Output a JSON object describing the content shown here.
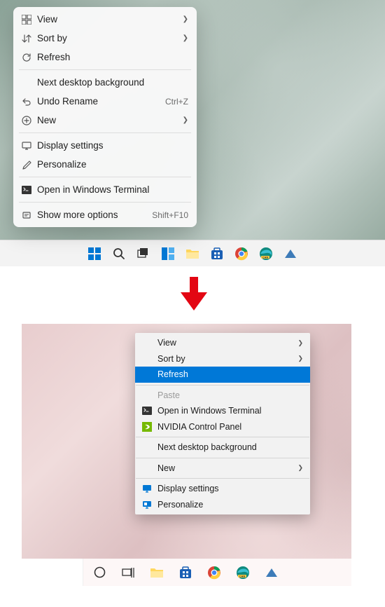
{
  "win11_menu": {
    "items": [
      {
        "label": "View",
        "icon": "view",
        "chevron": true
      },
      {
        "label": "Sort by",
        "icon": "sort",
        "chevron": true
      },
      {
        "label": "Refresh",
        "icon": "refresh"
      }
    ],
    "items2": [
      {
        "label": "Next desktop background"
      },
      {
        "label": "Undo Rename",
        "icon": "undo",
        "shortcut": "Ctrl+Z"
      },
      {
        "label": "New",
        "icon": "new",
        "chevron": true
      }
    ],
    "items3": [
      {
        "label": "Display settings",
        "icon": "display"
      },
      {
        "label": "Personalize",
        "icon": "personalize"
      }
    ],
    "items4": [
      {
        "label": "Open in Windows Terminal",
        "icon": "terminal"
      }
    ],
    "items5": [
      {
        "label": "Show more options",
        "icon": "more",
        "shortcut": "Shift+F10"
      }
    ]
  },
  "win10_menu": {
    "items": [
      {
        "label": "View",
        "chevron": true
      },
      {
        "label": "Sort by",
        "chevron": true
      },
      {
        "label": "Refresh",
        "highlighted": true
      }
    ],
    "items2": [
      {
        "label": "Paste",
        "disabled": true
      },
      {
        "label": "Open in Windows Terminal",
        "icon": "terminal"
      },
      {
        "label": "NVIDIA Control Panel",
        "icon": "nvidia"
      }
    ],
    "items3": [
      {
        "label": "Next desktop background"
      }
    ],
    "items4": [
      {
        "label": "New",
        "chevron": true
      }
    ],
    "items5": [
      {
        "label": "Display settings",
        "icon": "display10"
      },
      {
        "label": "Personalize",
        "icon": "personalize10"
      }
    ]
  },
  "taskbar_top": [
    "start",
    "search",
    "taskview",
    "widgets",
    "explorer",
    "store",
    "chrome",
    "edge",
    "app"
  ],
  "taskbar_bottom": [
    "cortana",
    "taskview",
    "explorer",
    "store",
    "chrome",
    "edge",
    "app"
  ]
}
